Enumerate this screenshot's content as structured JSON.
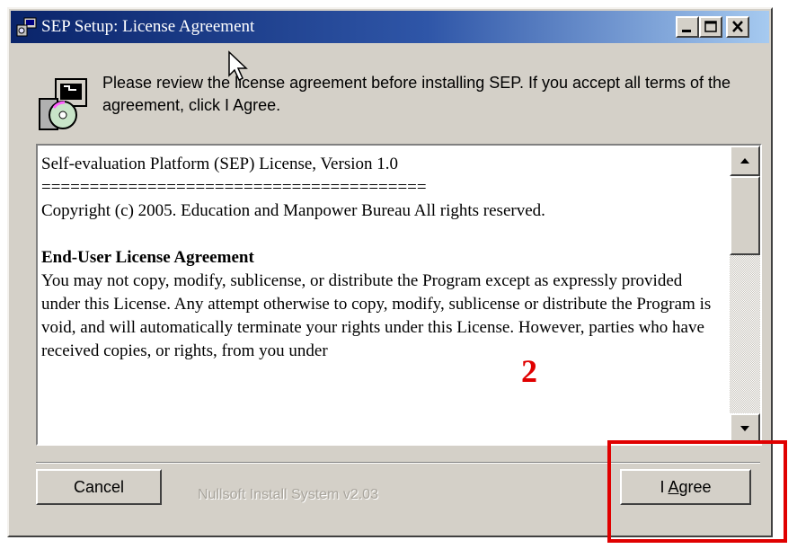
{
  "window": {
    "title": "SEP Setup: License Agreement",
    "controls": [
      "minimize-icon",
      "maximize-icon",
      "close-icon"
    ]
  },
  "header": {
    "description": "Please review the license agreement before installing SEP. If you accept all terms of the agreement, click I Agree."
  },
  "license": {
    "lines": [
      "Self-evaluation Platform (SEP) License, Version 1.0",
      "========================================",
      "Copyright (c) 2005. Education and Manpower Bureau All rights reserved."
    ],
    "heading": "End-User License Agreement",
    "body": "You may not copy, modify, sublicense, or distribute the Program except as expressly provided under this License. Any attempt otherwise to copy, modify, sublicense or distribute the Program is void, and will automatically terminate your rights under this License. However, parties who have received copies, or rights, from you under"
  },
  "footer": {
    "cancel_label": "Cancel",
    "branding": "Nullsoft Install System v2.03",
    "agree_label_prefix": "I ",
    "agree_label_accel": "A",
    "agree_label_suffix": "gree"
  },
  "annotation": {
    "step_number": "2",
    "color": "#e00000"
  },
  "colors": {
    "titlebar_start": "#0a246a",
    "titlebar_end": "#a6caf0",
    "face": "#d4d0c8"
  }
}
